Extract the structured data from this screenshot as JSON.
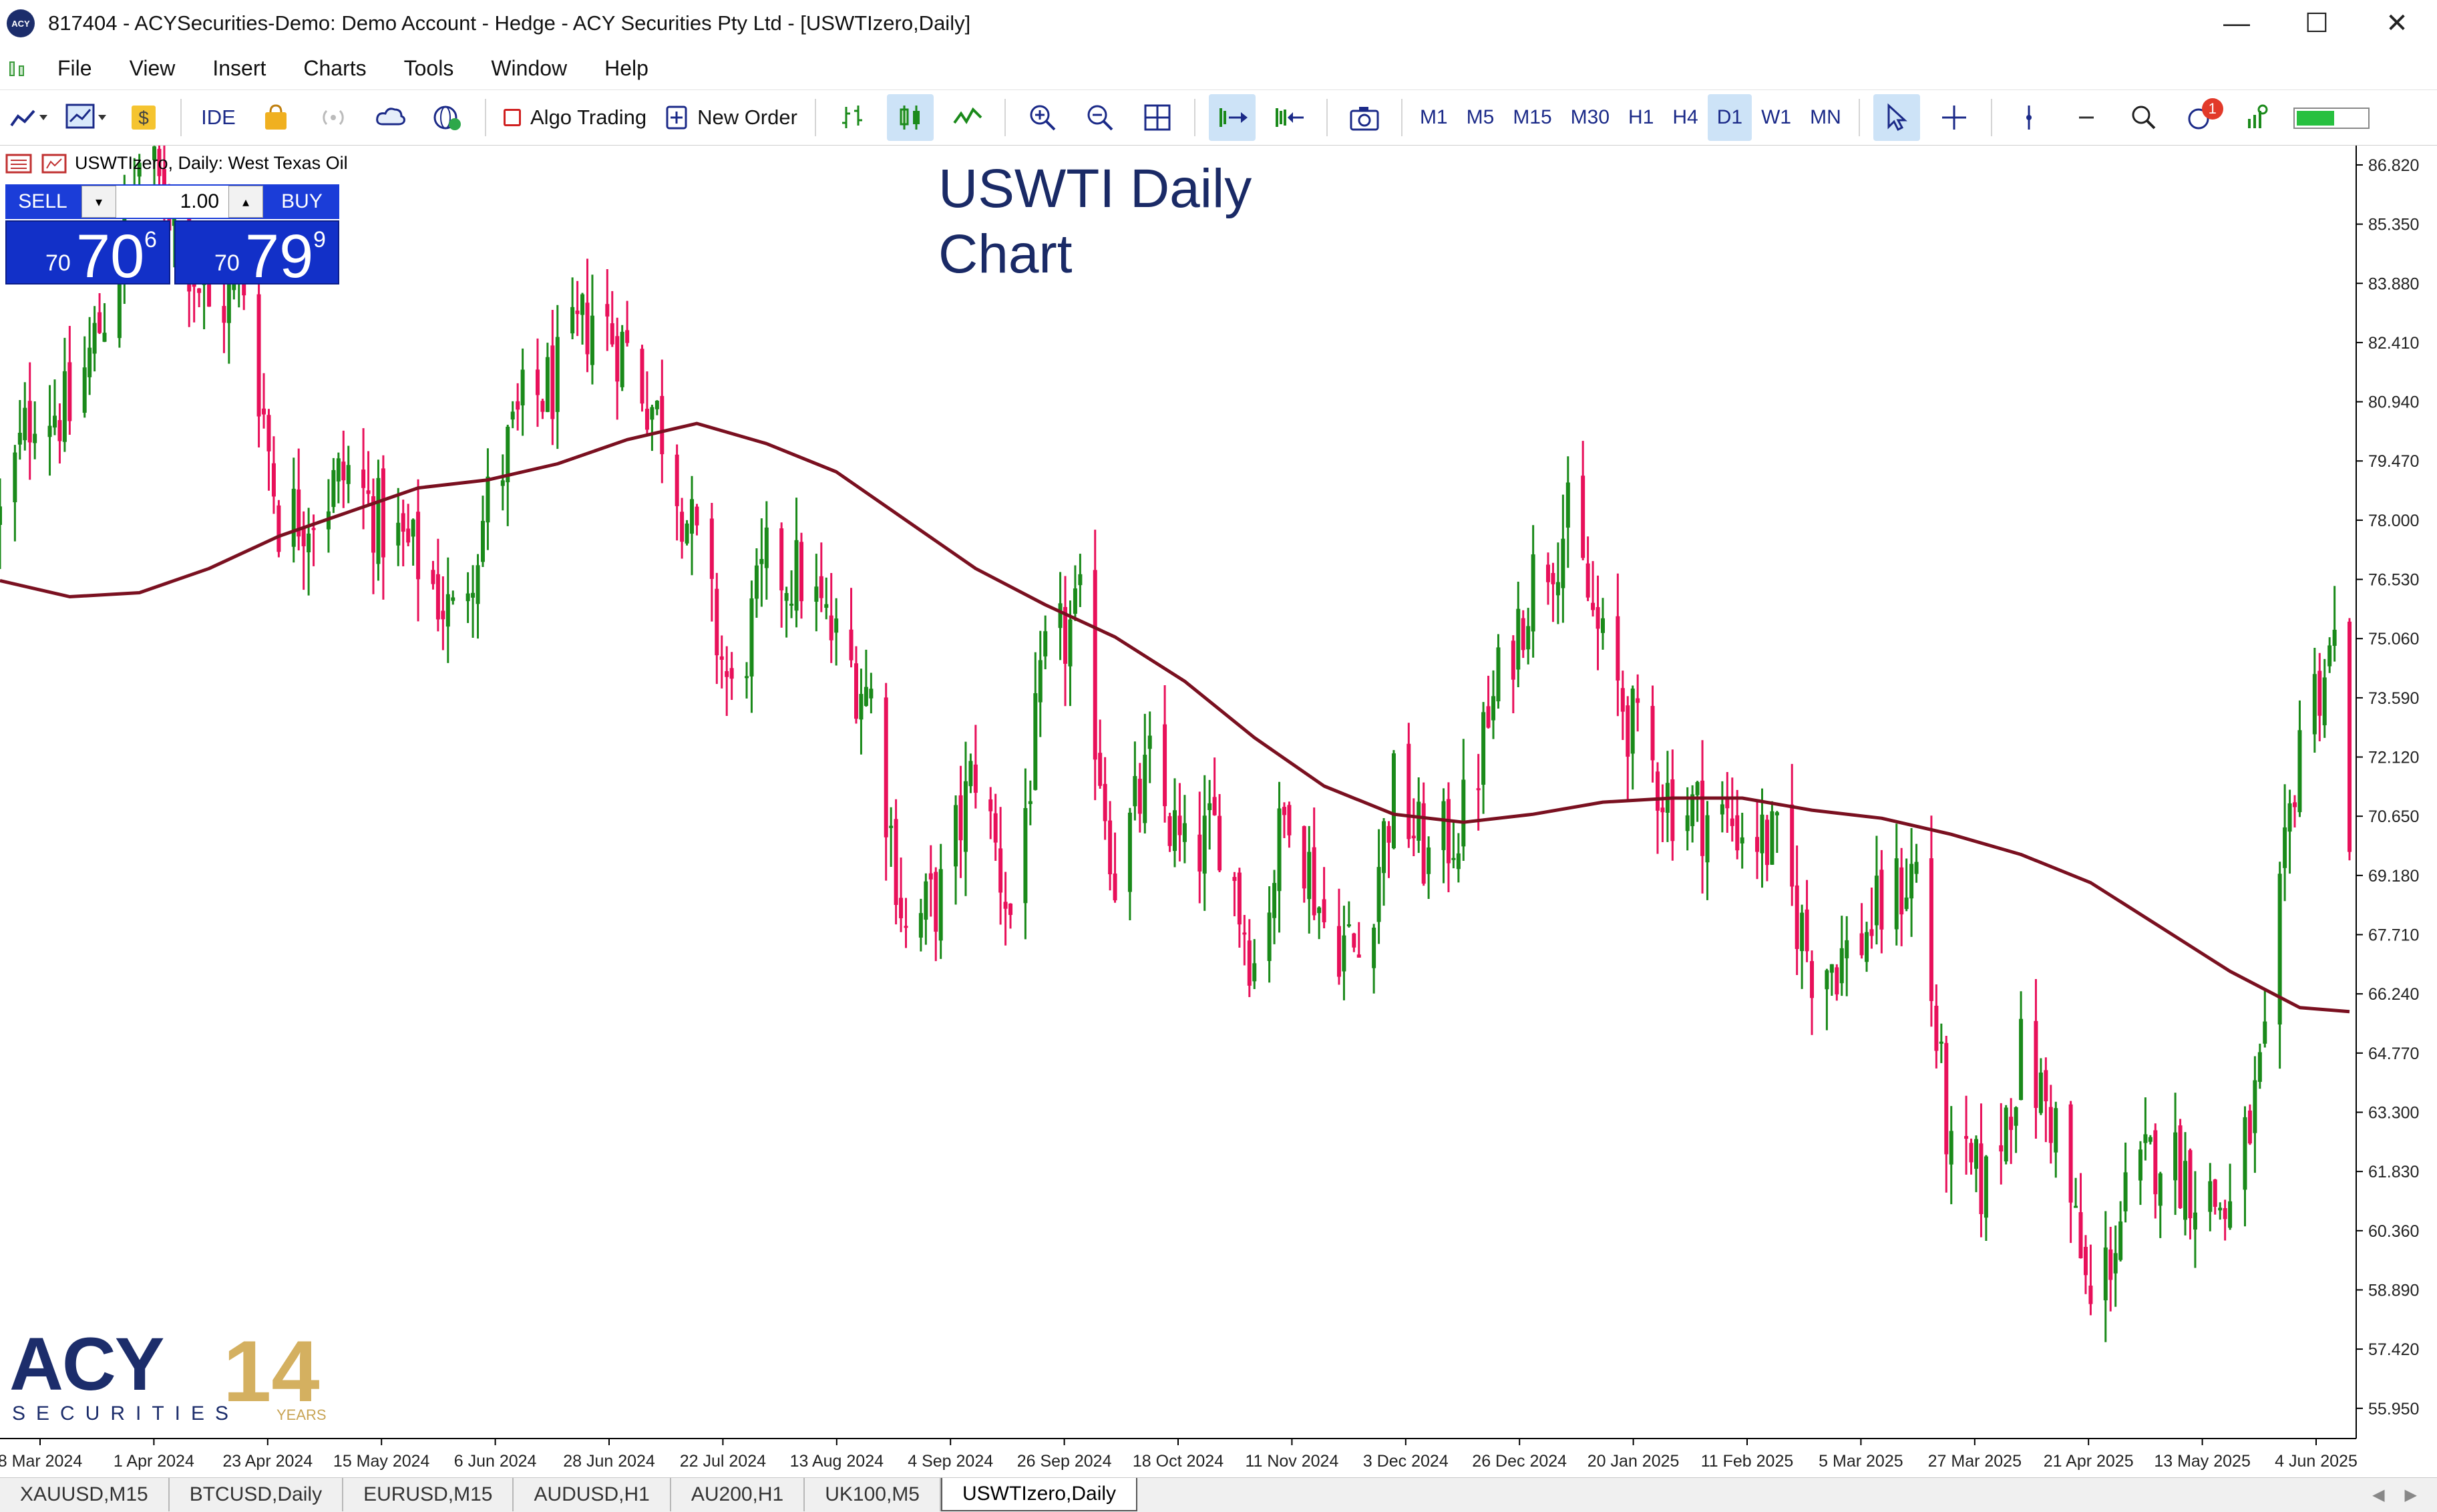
{
  "window": {
    "title": "817404 - ACYSecurities-Demo: Demo Account - Hedge - ACY Securities Pty Ltd - [USWTIzero,Daily]",
    "logo_text": "ACY",
    "minimize": "—",
    "maximize": "☐",
    "close": "✕"
  },
  "menu": {
    "items": [
      "File",
      "View",
      "Insert",
      "Charts",
      "Tools",
      "Window",
      "Help"
    ]
  },
  "toolbar": {
    "ide_label": "IDE",
    "algo_trading_label": "Algo Trading",
    "new_order_label": "New Order",
    "timeframes": [
      "M1",
      "M5",
      "M15",
      "M30",
      "H1",
      "H4",
      "D1",
      "W1",
      "MN"
    ],
    "active_timeframe": "D1",
    "notification_count": "1"
  },
  "chart": {
    "symbol_label": "USWTIzero, Daily:  West Texas Oil",
    "overlay_title_line1": "USWTI Daily",
    "overlay_title_line2": "Chart",
    "one_click": {
      "sell_label": "SELL",
      "buy_label": "BUY",
      "lot": "1.00",
      "sell_price_prefix": "70",
      "sell_price_big": "70",
      "sell_price_sup": "6",
      "buy_price_prefix": "70",
      "buy_price_big": "79",
      "buy_price_sup": "9"
    },
    "brand": {
      "name": "ACY",
      "sub": "SECURITIES",
      "years_number": "14",
      "years_text": "YEARS"
    },
    "colors": {
      "bull": "#1a8a1a",
      "bear": "#e8105a",
      "ma": "#7a1020",
      "ob_panel": "#1230c8"
    }
  },
  "chart_data": {
    "type": "candlestick",
    "title": "USWTI Daily Chart",
    "symbol": "USWTIzero",
    "timeframe": "Daily",
    "y_ticks": [
      "86.820",
      "85.350",
      "83.880",
      "82.410",
      "80.940",
      "79.470",
      "78.000",
      "76.530",
      "75.060",
      "73.590",
      "72.120",
      "70.650",
      "69.180",
      "67.710",
      "66.240",
      "64.770",
      "63.300",
      "61.830",
      "60.360",
      "58.890",
      "57.420",
      "55.950"
    ],
    "ylim": [
      55.2,
      87.3
    ],
    "x_ticks": [
      "8 Mar 2024",
      "1 Apr 2024",
      "23 Apr 2024",
      "15 May 2024",
      "6 Jun 2024",
      "28 Jun 2024",
      "22 Jul 2024",
      "13 Aug 2024",
      "4 Sep 2024",
      "26 Sep 2024",
      "18 Oct 2024",
      "11 Nov 2024",
      "3 Dec 2024",
      "26 Dec 2024",
      "20 Jan 2025",
      "11 Feb 2025",
      "5 Mar 2025",
      "27 Mar 2025",
      "21 Apr 2025",
      "13 May 2025",
      "4 Jun 2025"
    ],
    "close_path": [
      [
        "2024-03-08",
        78.0
      ],
      [
        "2024-03-15",
        81.0
      ],
      [
        "2024-03-22",
        80.6
      ],
      [
        "2024-03-29",
        83.2
      ],
      [
        "2024-04-05",
        86.9
      ],
      [
        "2024-04-12",
        85.7
      ],
      [
        "2024-04-19",
        83.1
      ],
      [
        "2024-04-26",
        83.9
      ],
      [
        "2024-05-03",
        78.1
      ],
      [
        "2024-05-10",
        78.3
      ],
      [
        "2024-05-17",
        79.2
      ],
      [
        "2024-05-24",
        77.8
      ],
      [
        "2024-05-31",
        77.0
      ],
      [
        "2024-06-07",
        75.5
      ],
      [
        "2024-06-14",
        78.4
      ],
      [
        "2024-06-21",
        80.7
      ],
      [
        "2024-06-28",
        81.5
      ],
      [
        "2024-07-05",
        83.2
      ],
      [
        "2024-07-12",
        82.2
      ],
      [
        "2024-07-19",
        80.3
      ],
      [
        "2024-07-26",
        77.2
      ],
      [
        "2024-08-02",
        73.5
      ],
      [
        "2024-08-09",
        76.8
      ],
      [
        "2024-08-16",
        76.6
      ],
      [
        "2024-08-23",
        74.9
      ],
      [
        "2024-08-30",
        73.6
      ],
      [
        "2024-09-06",
        67.7
      ],
      [
        "2024-09-13",
        68.7
      ],
      [
        "2024-09-20",
        71.9
      ],
      [
        "2024-09-27",
        68.2
      ],
      [
        "2024-10-04",
        74.4
      ],
      [
        "2024-10-11",
        75.6
      ],
      [
        "2024-10-18",
        69.2
      ],
      [
        "2024-10-25",
        71.8
      ],
      [
        "2024-11-01",
        69.5
      ],
      [
        "2024-11-08",
        70.4
      ],
      [
        "2024-11-15",
        67.0
      ],
      [
        "2024-11-22",
        71.2
      ],
      [
        "2024-11-29",
        68.0
      ],
      [
        "2024-12-06",
        67.2
      ],
      [
        "2024-12-13",
        71.3
      ],
      [
        "2024-12-20",
        69.5
      ],
      [
        "2024-12-27",
        70.6
      ],
      [
        "2025-01-03",
        73.9
      ],
      [
        "2025-01-10",
        76.6
      ],
      [
        "2025-01-17",
        77.9
      ],
      [
        "2025-01-24",
        74.7
      ],
      [
        "2025-01-31",
        72.5
      ],
      [
        "2025-02-07",
        71.0
      ],
      [
        "2025-02-14",
        70.7
      ],
      [
        "2025-02-21",
        70.4
      ],
      [
        "2025-02-28",
        69.8
      ],
      [
        "2025-03-07",
        67.0
      ],
      [
        "2025-03-14",
        67.2
      ],
      [
        "2025-03-21",
        68.3
      ],
      [
        "2025-03-28",
        69.4
      ],
      [
        "2025-04-04",
        61.9
      ],
      [
        "2025-04-11",
        61.5
      ],
      [
        "2025-04-18",
        64.7
      ],
      [
        "2025-04-25",
        63.0
      ],
      [
        "2025-05-02",
        58.3
      ],
      [
        "2025-05-09",
        61.0
      ],
      [
        "2025-05-16",
        62.5
      ],
      [
        "2025-05-23",
        61.5
      ],
      [
        "2025-05-30",
        60.8
      ],
      [
        "2025-06-06",
        64.6
      ],
      [
        "2025-06-13",
        72.9
      ],
      [
        "2025-06-20",
        74.9
      ],
      [
        "2025-06-23",
        70.6
      ]
    ],
    "ma_path": [
      [
        "2024-03-08",
        76.5
      ],
      [
        "2024-03-22",
        76.1
      ],
      [
        "2024-04-05",
        76.2
      ],
      [
        "2024-04-19",
        76.8
      ],
      [
        "2024-05-03",
        77.6
      ],
      [
        "2024-05-17",
        78.2
      ],
      [
        "2024-05-31",
        78.8
      ],
      [
        "2024-06-14",
        79.0
      ],
      [
        "2024-06-28",
        79.4
      ],
      [
        "2024-07-12",
        80.0
      ],
      [
        "2024-07-26",
        80.4
      ],
      [
        "2024-08-09",
        79.9
      ],
      [
        "2024-08-23",
        79.2
      ],
      [
        "2024-09-06",
        78.0
      ],
      [
        "2024-09-20",
        76.8
      ],
      [
        "2024-10-04",
        75.9
      ],
      [
        "2024-10-18",
        75.1
      ],
      [
        "2024-11-01",
        74.0
      ],
      [
        "2024-11-15",
        72.6
      ],
      [
        "2024-11-29",
        71.4
      ],
      [
        "2024-12-13",
        70.7
      ],
      [
        "2024-12-27",
        70.5
      ],
      [
        "2025-01-10",
        70.7
      ],
      [
        "2025-01-24",
        71.0
      ],
      [
        "2025-02-07",
        71.1
      ],
      [
        "2025-02-21",
        71.1
      ],
      [
        "2025-03-07",
        70.8
      ],
      [
        "2025-03-21",
        70.6
      ],
      [
        "2025-04-04",
        70.2
      ],
      [
        "2025-04-18",
        69.7
      ],
      [
        "2025-05-02",
        69.0
      ],
      [
        "2025-05-16",
        67.9
      ],
      [
        "2025-05-30",
        66.8
      ],
      [
        "2025-06-13",
        65.9
      ],
      [
        "2025-06-23",
        65.8
      ]
    ],
    "spike_high": 74.9,
    "spike_date": "2025-06-20"
  },
  "tabs": {
    "items": [
      "XAUUSD,M15",
      "BTCUSD,Daily",
      "EURUSD,M15",
      "AUDUSD,H1",
      "AU200,H1",
      "UK100,M5",
      "USWTIzero,Daily"
    ],
    "active": "USWTIzero,Daily"
  }
}
